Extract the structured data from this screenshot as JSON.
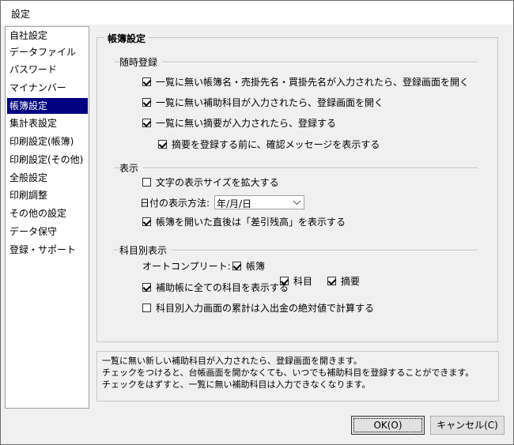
{
  "window": {
    "title": "設定"
  },
  "sidebar": {
    "items": [
      {
        "label": "自社設定"
      },
      {
        "label": "データファイル"
      },
      {
        "label": "パスワード"
      },
      {
        "label": "マイナンバー"
      },
      {
        "label": "帳簿設定",
        "selected": true
      },
      {
        "label": "集計表設定"
      },
      {
        "label": "印刷設定(帳簿)"
      },
      {
        "label": "印刷設定(その他)"
      },
      {
        "label": "全般設定"
      },
      {
        "label": "印刷調整"
      },
      {
        "label": "その他の設定"
      },
      {
        "label": "データ保守"
      },
      {
        "label": "登録・サポート"
      }
    ]
  },
  "panel": {
    "title": "帳簿設定",
    "group_zuiji": {
      "title": "随時登録",
      "cb1": {
        "label": "一覧に無い帳簿名・売掛先名・買掛先名が入力されたら、登録画面を開く",
        "checked": true
      },
      "cb2": {
        "label": "一覧に無い補助科目が入力されたら、登録画面を開く",
        "checked": true
      },
      "cb3": {
        "label": "一覧に無い摘要が入力されたら、登録する",
        "checked": true
      },
      "cb4": {
        "label": "摘要を登録する前に、確認メッセージを表示する",
        "checked": true
      }
    },
    "group_display": {
      "title": "表示",
      "cb_fontsize": {
        "label": "文字の表示サイズを拡大する",
        "checked": false
      },
      "date_label": "日付の表示方法:",
      "date_value": "年/月/日",
      "cb_sashihiki": {
        "label": "帳簿を開いた直後は「差引残高」を表示する",
        "checked": true
      }
    },
    "group_kamoku": {
      "title": "科目別表示",
      "autocomplete_label": "オートコンプリート:",
      "ac_choubo": {
        "label": "帳簿",
        "checked": true
      },
      "ac_kamoku": {
        "label": "科目",
        "checked": true
      },
      "ac_tekiyou": {
        "label": "摘要",
        "checked": true
      },
      "cb_hojo": {
        "label": "補助帳に全ての科目を表示する",
        "checked": true
      },
      "cb_ruikei": {
        "label": "科目別入力画面の累計は入出金の絶対値で計算する",
        "checked": false
      }
    }
  },
  "description": {
    "lines": [
      "一覧に無い新しい補助科目が入力されたら、登録画面を開きます。",
      "チェックをつけると、台帳画面を開かなくても、いつでも補助科目を登録することができます。",
      "チェックをはずすと、一覧に無い補助科目は入力できなくなります。"
    ]
  },
  "buttons": {
    "ok": "OK(O)",
    "cancel": "キャンセル(C)"
  }
}
